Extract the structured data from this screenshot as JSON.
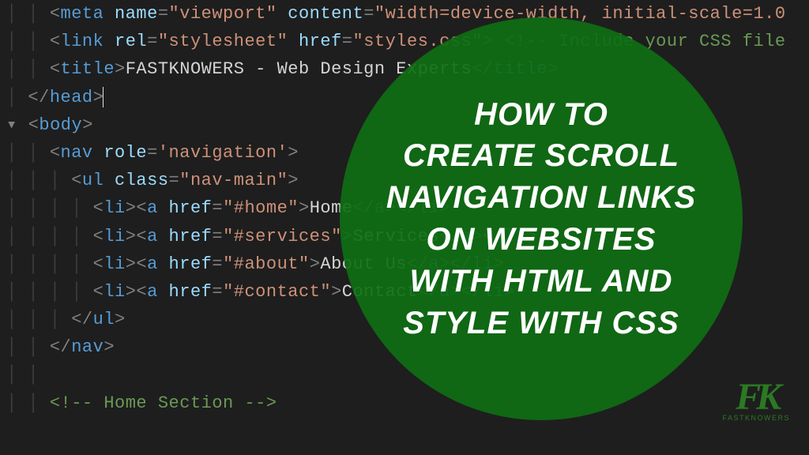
{
  "code": {
    "meta_tag": "meta",
    "meta_name_attr": " name",
    "meta_name_val": "\"viewport\"",
    "meta_content_attr": " content",
    "meta_content_val": "\"width=device-width, initial-scale=1.0",
    "link_tag": "link",
    "link_rel_attr": " rel",
    "link_rel_val": "\"stylesheet\"",
    "link_href_attr": " href",
    "link_href_val": "\"styles.css\"",
    "link_comment": " <!-- Include your CSS file",
    "title_tag": "title",
    "title_text": "FASTKNOWERS - Web Design Experts",
    "title_close": "title",
    "head_close": "head",
    "body_tag": "body",
    "nav_tag": "nav",
    "nav_role_attr": " role",
    "nav_role_val": "'navigation'",
    "ul_tag": "ul",
    "ul_class_attr": " class",
    "ul_class_val": "\"nav-main\"",
    "li_tag": "li",
    "a_tag": "a",
    "href_attr": " href",
    "href_home": "\"#home\"",
    "txt_home": "Home",
    "href_services": "\"#services\"",
    "txt_services": "Services",
    "href_about": "\"#about\"",
    "txt_about": "About Us",
    "href_contact": "\"#contact\"",
    "txt_contact": "Contact",
    "ul_close": "ul",
    "nav_close": "nav",
    "home_comment": "<!-- Home Section -->"
  },
  "overlay": {
    "line1": "HOW TO",
    "line2": "CREATE SCROLL",
    "line3": "NAVIGATION LINKS",
    "line4": "ON WEBSITES",
    "line5": "WITH HTML AND",
    "line6": "STYLE WITH CSS"
  },
  "brand": {
    "mark": "FK",
    "word": "FASTKNOWERS"
  }
}
